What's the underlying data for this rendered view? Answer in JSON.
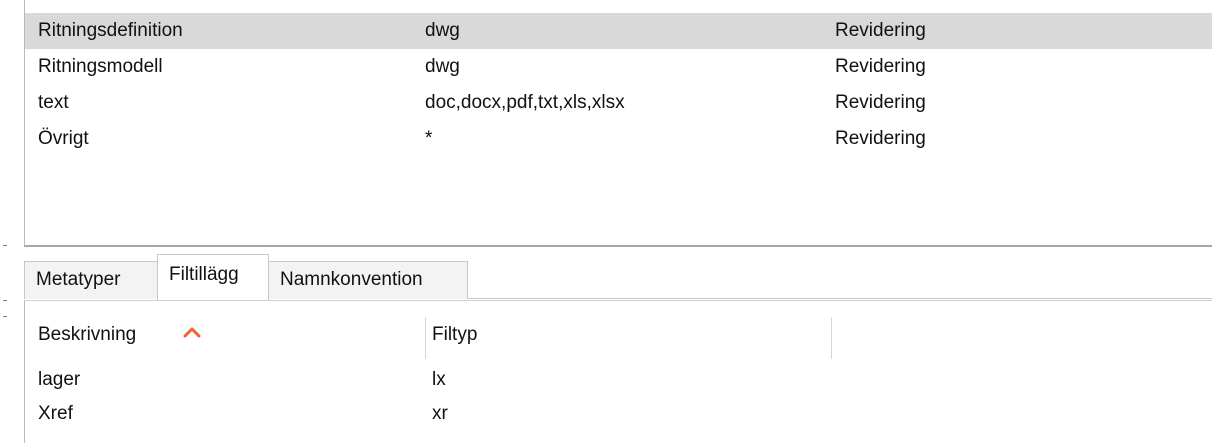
{
  "upper_list": {
    "rows": [
      {
        "name": "Ritningsdefinition",
        "extensions": "dwg",
        "type": "Revidering",
        "selected": true
      },
      {
        "name": "Ritningsmodell",
        "extensions": "dwg",
        "type": "Revidering",
        "selected": false
      },
      {
        "name": "text",
        "extensions": "doc,docx,pdf,txt,xls,xlsx",
        "type": "Revidering",
        "selected": false
      },
      {
        "name": "Övrigt",
        "extensions": "*",
        "type": "Revidering",
        "selected": false
      }
    ]
  },
  "tabs": [
    {
      "label": "Metatyper",
      "active": false
    },
    {
      "label": "Filtillägg",
      "active": true
    },
    {
      "label": "Namnkonvention",
      "active": false
    }
  ],
  "lower_grid": {
    "columns": [
      {
        "label": "Beskrivning",
        "sort": "ascending"
      },
      {
        "label": "Filtyp"
      }
    ],
    "rows": [
      {
        "description": "lager",
        "filetype": "lx"
      },
      {
        "description": "Xref",
        "filetype": "xr"
      }
    ]
  },
  "colors": {
    "selection": "#d9d9d9",
    "sort_arrow": "#e8643a",
    "border": "#c8c8c8"
  },
  "icons": {
    "sort": "chevron-up-icon"
  }
}
